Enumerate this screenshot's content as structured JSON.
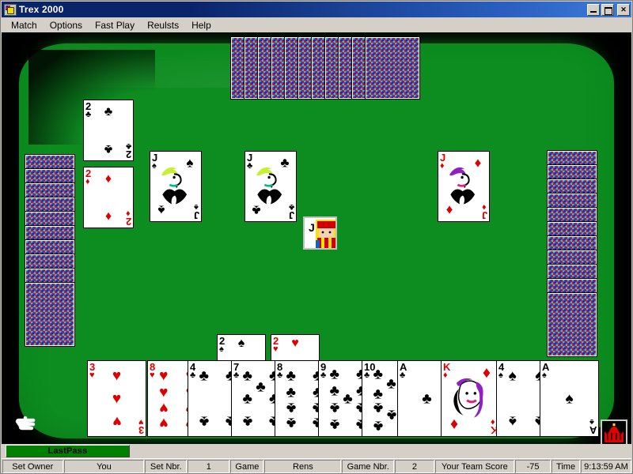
{
  "window": {
    "title": "Trex 2000",
    "icon": "app-icon",
    "buttons": {
      "minimize": "_",
      "maximize": "□",
      "close": "✕"
    }
  },
  "menu": {
    "items": [
      {
        "label": "Match"
      },
      {
        "label": "Options"
      },
      {
        "label": "Fast Play"
      },
      {
        "label": "Reulsts"
      },
      {
        "label": "Help"
      }
    ]
  },
  "table": {
    "felt_color": "#0d8c20",
    "border_color": "#000000"
  },
  "hands": {
    "north": {
      "label": "north-hand",
      "facedown_count": 11,
      "orientation": "horizontal"
    },
    "west": {
      "label": "west-hand",
      "facedown_count": 10,
      "orientation": "vertical"
    },
    "east": {
      "label": "east-hand",
      "facedown_count": 11,
      "orientation": "vertical"
    },
    "south": {
      "label": "player-hand",
      "cards": [
        {
          "rank": "3",
          "suit": "hearts",
          "symbol": "♥",
          "color": "red"
        },
        {
          "rank": "8",
          "suit": "hearts",
          "symbol": "♥",
          "color": "red"
        },
        {
          "rank": "4",
          "suit": "clubs",
          "symbol": "♣",
          "color": "black"
        },
        {
          "rank": "7",
          "suit": "clubs",
          "symbol": "♣",
          "color": "black"
        },
        {
          "rank": "8",
          "suit": "clubs",
          "symbol": "♣",
          "color": "black"
        },
        {
          "rank": "9",
          "suit": "clubs",
          "symbol": "♣",
          "color": "black"
        },
        {
          "rank": "10",
          "suit": "clubs",
          "symbol": "♣",
          "color": "black"
        },
        {
          "rank": "A",
          "suit": "clubs",
          "symbol": "♣",
          "color": "black"
        },
        {
          "rank": "K",
          "suit": "diamonds",
          "symbol": "♦",
          "color": "red"
        },
        {
          "rank": "4",
          "suit": "spades",
          "symbol": "♠",
          "color": "black"
        },
        {
          "rank": "A",
          "suit": "spades",
          "symbol": "♠",
          "color": "black"
        }
      ]
    }
  },
  "trick": {
    "label": "current-trick",
    "cards": [
      {
        "position": "west",
        "rank": "J",
        "suit": "spades",
        "symbol": "♠",
        "color": "black",
        "hat": "#c8f032"
      },
      {
        "position": "north",
        "rank": "J",
        "suit": "clubs",
        "symbol": "♣",
        "color": "black",
        "hat": "#c8f032"
      },
      {
        "position": "east",
        "rank": "J",
        "suit": "diamonds",
        "symbol": "♦",
        "color": "red",
        "hat": "#9020c0"
      }
    ],
    "lead_indicator": {
      "rank": "J",
      "label": "lead-card-indicator"
    }
  },
  "captured": {
    "west_pile": [
      {
        "rank": "2",
        "suit": "clubs",
        "symbol": "♣",
        "color": "black"
      },
      {
        "rank": "2",
        "suit": "diamonds",
        "symbol": "♦",
        "color": "red"
      }
    ],
    "south_pile": [
      {
        "rank": "2",
        "suit": "spades",
        "symbol": "♠",
        "color": "black"
      },
      {
        "rank": "2",
        "suit": "hearts",
        "symbol": "♥",
        "color": "red"
      }
    ]
  },
  "indicators": {
    "crown": {
      "label": "king-of-hearts-indicator",
      "color": "#e00000"
    },
    "pointer": {
      "label": "turn-pointer"
    }
  },
  "status": {
    "last_pass_button": "LastPass",
    "fields": [
      {
        "label": "Set Owner",
        "value": "You"
      },
      {
        "label": "Set Nbr.",
        "value": "1"
      },
      {
        "label": "Game",
        "value": "Rens"
      },
      {
        "label": "Game Nbr.",
        "value": "2"
      },
      {
        "label": "Your Team Score",
        "value": "-75"
      },
      {
        "label": "Time",
        "value": "9:13:59 AM"
      }
    ]
  }
}
